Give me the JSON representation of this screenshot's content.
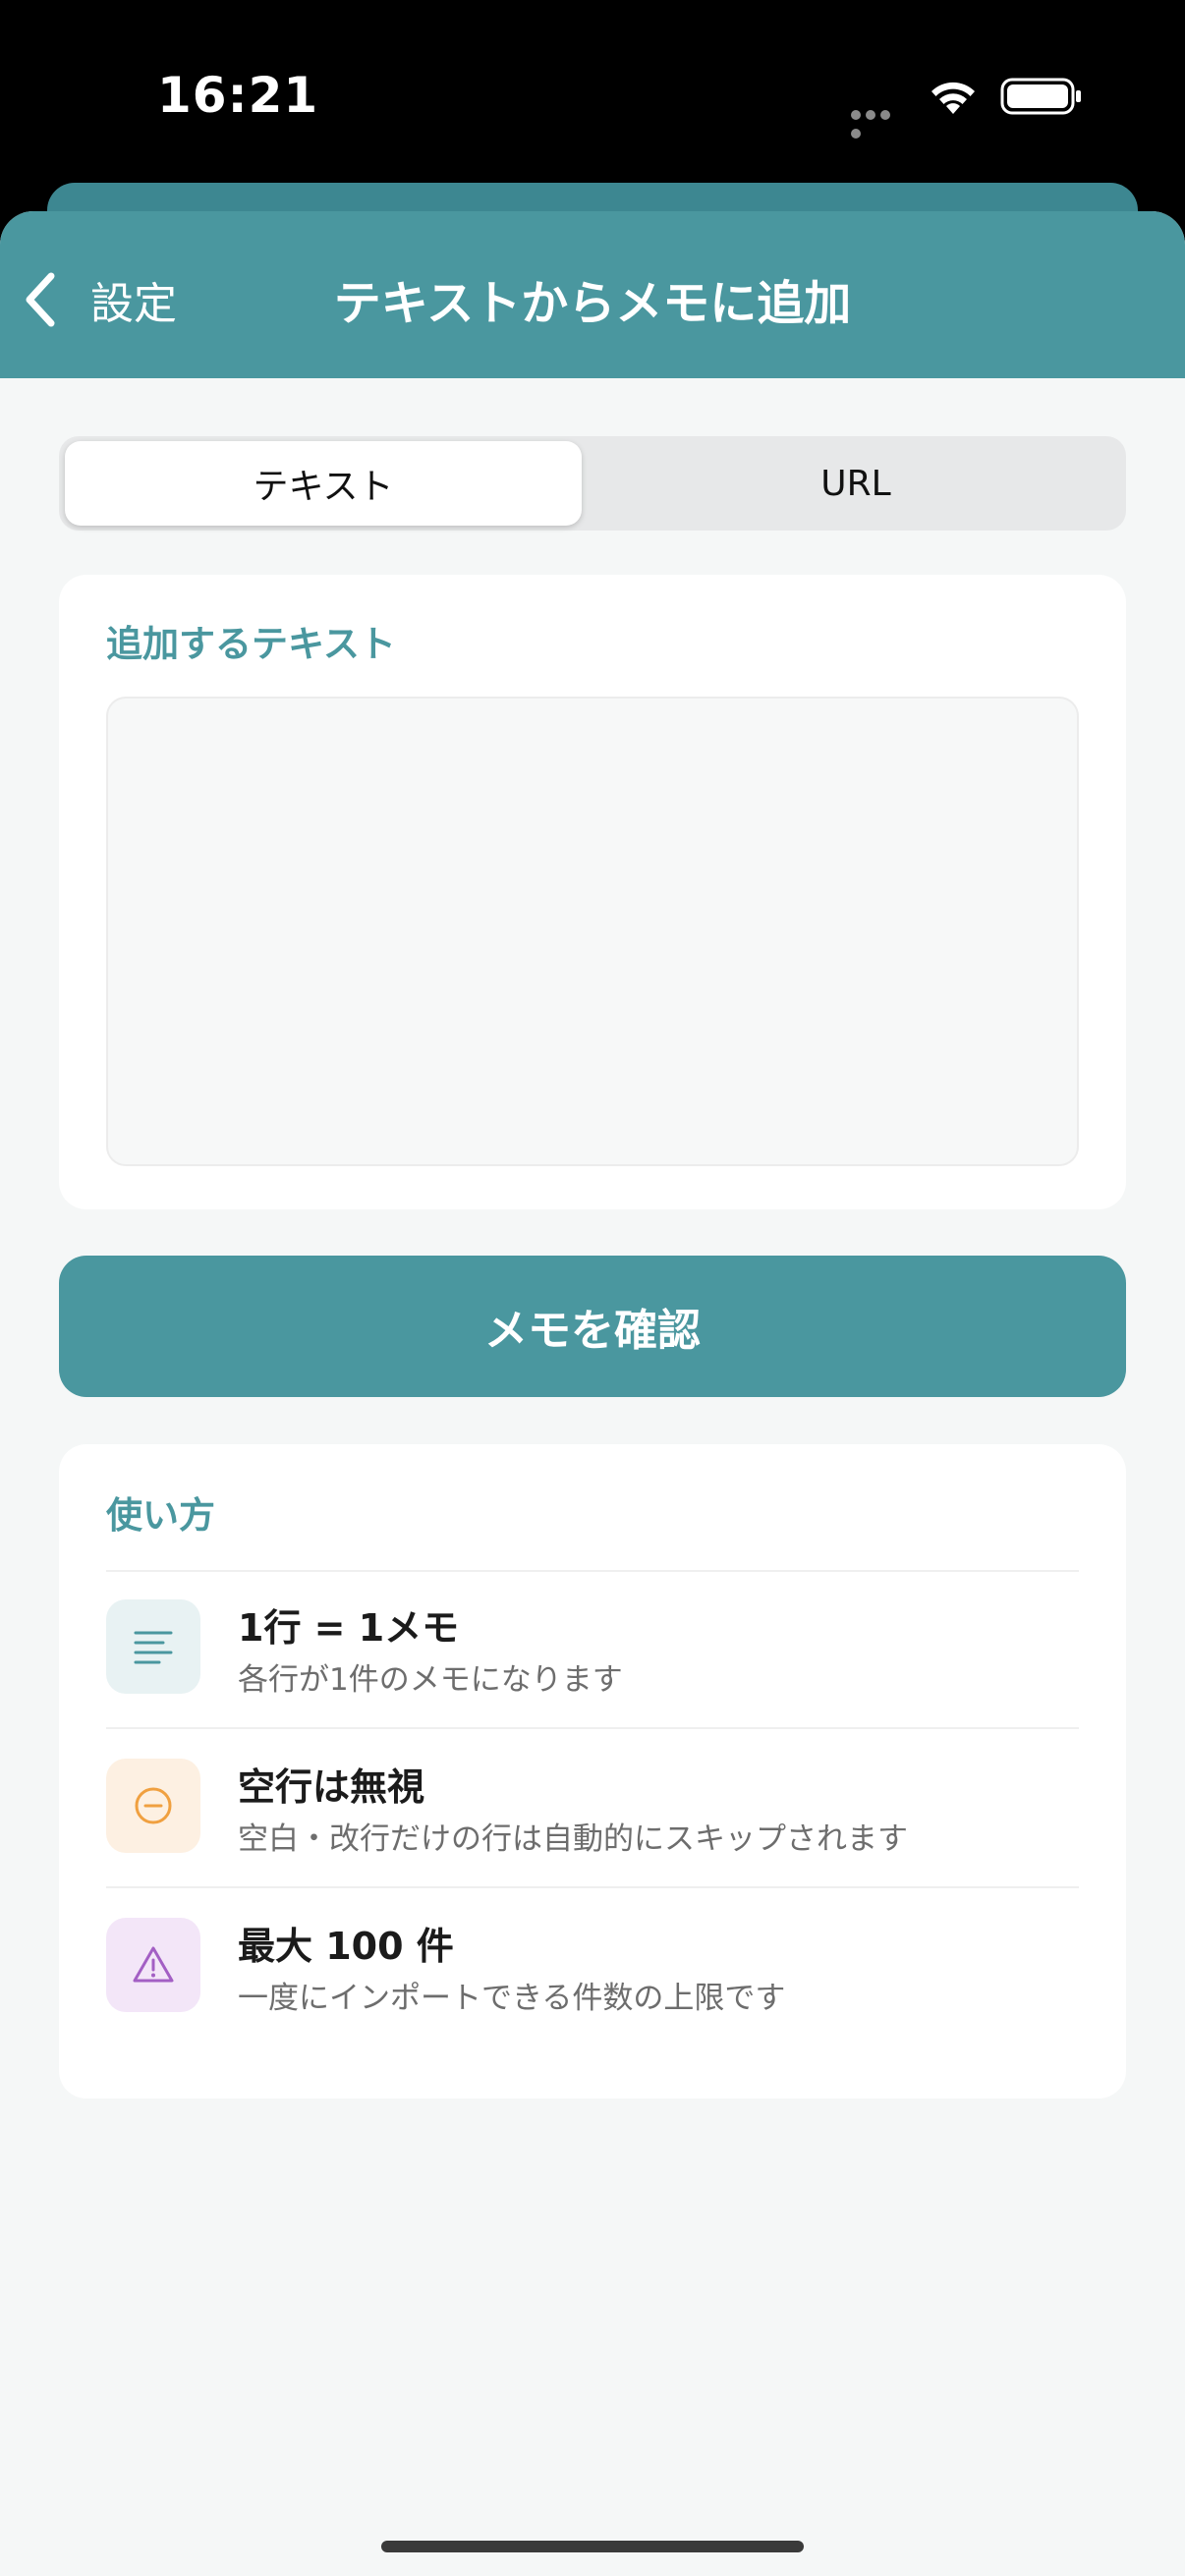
{
  "status_bar": {
    "time": "16:21"
  },
  "nav": {
    "back_label": "設定",
    "title": "テキストからメモに追加"
  },
  "segmented": {
    "options": [
      "テキスト",
      "URL"
    ],
    "selected": "テキスト"
  },
  "text_section": {
    "label": "追加するテキスト",
    "value": "",
    "placeholder": ""
  },
  "confirm_button": {
    "label": "メモを確認"
  },
  "howto": {
    "label": "使い方",
    "items": [
      {
        "title": "1行 = 1メモ",
        "description": "各行が1件のメモになります",
        "icon": "text-lines-icon",
        "icon_color": "#4a979f",
        "icon_bg": "#e8f2f3"
      },
      {
        "title": "空行は無視",
        "description": "空白・改行だけの行は自動的にスキップされます",
        "icon": "minus-circle-icon",
        "icon_color": "#f0a040",
        "icon_bg": "#fdf0e2"
      },
      {
        "title": "最大 100 件",
        "description": "一度にインポートできる件数の上限です",
        "icon": "warning-triangle-icon",
        "icon_color": "#a35fc4",
        "icon_bg": "#f3e6f8"
      }
    ]
  },
  "colors": {
    "accent": "#4a979f",
    "background": "#f5f7f7",
    "card": "#ffffff"
  }
}
